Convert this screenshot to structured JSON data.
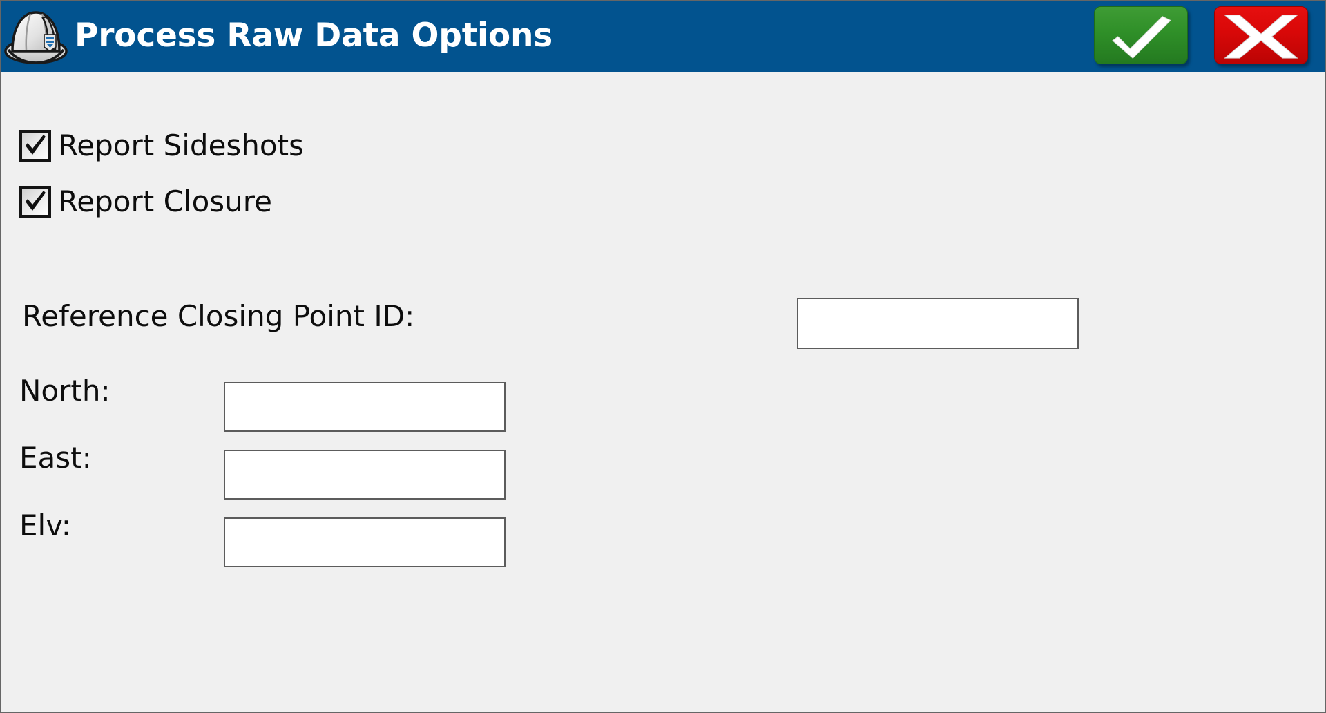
{
  "window": {
    "title": "Process Raw Data Options",
    "icon": "hard-hat-icon",
    "titlebar_color": "#02538f",
    "background_color": "#f0f0f0"
  },
  "titlebar_buttons": {
    "ok": {
      "icon": "checkmark-icon",
      "label": "",
      "color": "#2f8f28"
    },
    "cancel": {
      "icon": "x-icon",
      "label": "X",
      "color": "#d80808"
    }
  },
  "checkboxes": [
    {
      "label": "Report Sideshots",
      "checked": true
    },
    {
      "label": "Report Closure",
      "checked": true
    }
  ],
  "fields": [
    {
      "label": "Reference Closing Point ID:",
      "value": "",
      "placeholder": ""
    },
    {
      "label": "North:",
      "value": "",
      "placeholder": ""
    },
    {
      "label": "East:",
      "value": "",
      "placeholder": ""
    },
    {
      "label": "Elv:",
      "value": "",
      "placeholder": ""
    }
  ]
}
